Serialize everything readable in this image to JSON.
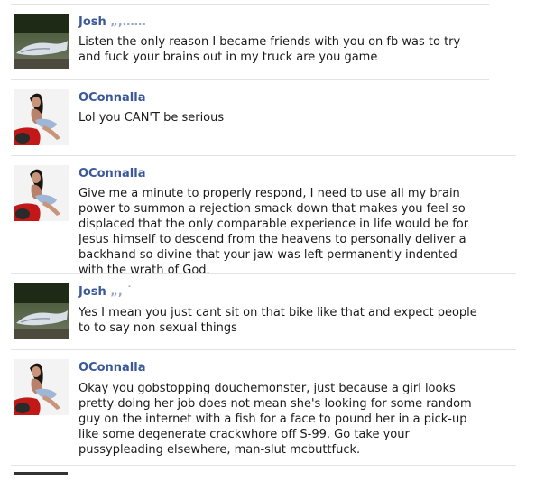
{
  "messages": [
    {
      "name": "Josh",
      "redacted": "„,……",
      "avatar": "fish-photo",
      "text": "Listen the only reason I became friends with you on fb was to try and fuck your brains out in my truck are you game"
    },
    {
      "name": "OConnalla",
      "avatar": "woman-on-motorcycle-photo",
      "text": "Lol you CAN'T be serious"
    },
    {
      "name": "OConnalla",
      "avatar": "woman-on-motorcycle-photo",
      "text": "Give me a minute to properly respond, I need to use all my brain power to summon a rejection smack down that makes you feel so displaced that the only comparable experience in life would be for Jesus himself to descend from the heavens to personally deliver a backhand so divine that your jaw was left permanently indented with the wrath of God."
    },
    {
      "name": "Josh",
      "redacted": "„, ˙",
      "avatar": "fish-photo",
      "text": "Yes I mean you just cant sit on that bike like that and expect people to to say non sexual things"
    },
    {
      "name": "OConnalla",
      "avatar": "woman-on-motorcycle-photo",
      "text": "Okay you gobstopping douchemonster, just because a girl looks pretty doing her job does not mean she's looking for some random guy on the internet with a fish for a face to pound her in a pick-up like some degenerate crackwhore off S-99. Go take your pussypleading elsewhere, man-slut mcbuttfuck."
    }
  ]
}
